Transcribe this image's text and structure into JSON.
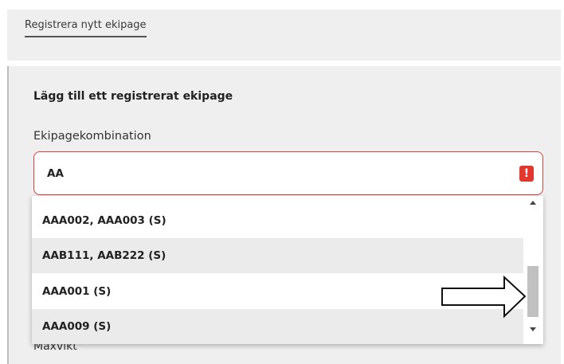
{
  "header": {
    "tab_label": "Registrera nytt ekipage"
  },
  "form": {
    "section_title": "Lägg till ett registrerat ekipage",
    "combination_label": "Ekipagekombination",
    "combination_value": "AA",
    "error_icon": "exclamation-icon",
    "maxvikt_label": "Maxvikt"
  },
  "dropdown": {
    "options": [
      "AAA002, AAA003 (S)",
      "AAB111, AAB222 (S)",
      "AAA001 (S)",
      "AAA009 (S)"
    ]
  },
  "annotation": {
    "icon": "arrow-right-outline-icon"
  },
  "colors": {
    "panel_background": "#efefef",
    "error_red": "#e0372f",
    "input_border_error": "#d9413f",
    "option_shaded": "#ebebeb"
  }
}
